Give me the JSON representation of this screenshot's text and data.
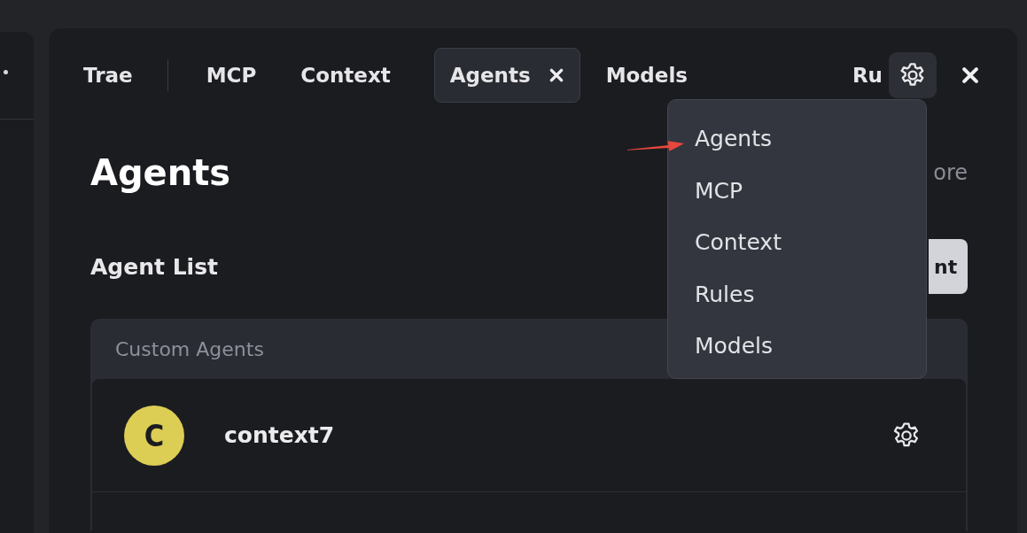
{
  "tabs": [
    {
      "label": "Trae",
      "selected": false
    },
    {
      "label": "MCP",
      "selected": false
    },
    {
      "label": "Context",
      "selected": false
    },
    {
      "label": "Agents",
      "selected": true
    },
    {
      "label": "Models",
      "selected": false
    },
    {
      "label": "Ru",
      "selected": false
    }
  ],
  "settings_menu": {
    "open": true,
    "items": [
      {
        "label": "Agents"
      },
      {
        "label": "MCP"
      },
      {
        "label": "Context"
      },
      {
        "label": "Rules"
      },
      {
        "label": "Models"
      }
    ]
  },
  "page": {
    "title": "Agents",
    "link": "ore",
    "section_title": "Agent List",
    "button": "nt"
  },
  "agent_group": {
    "title": "Custom Agents",
    "agents": [
      {
        "initial": "C",
        "name": "context7",
        "color": "#dccd55"
      }
    ]
  }
}
